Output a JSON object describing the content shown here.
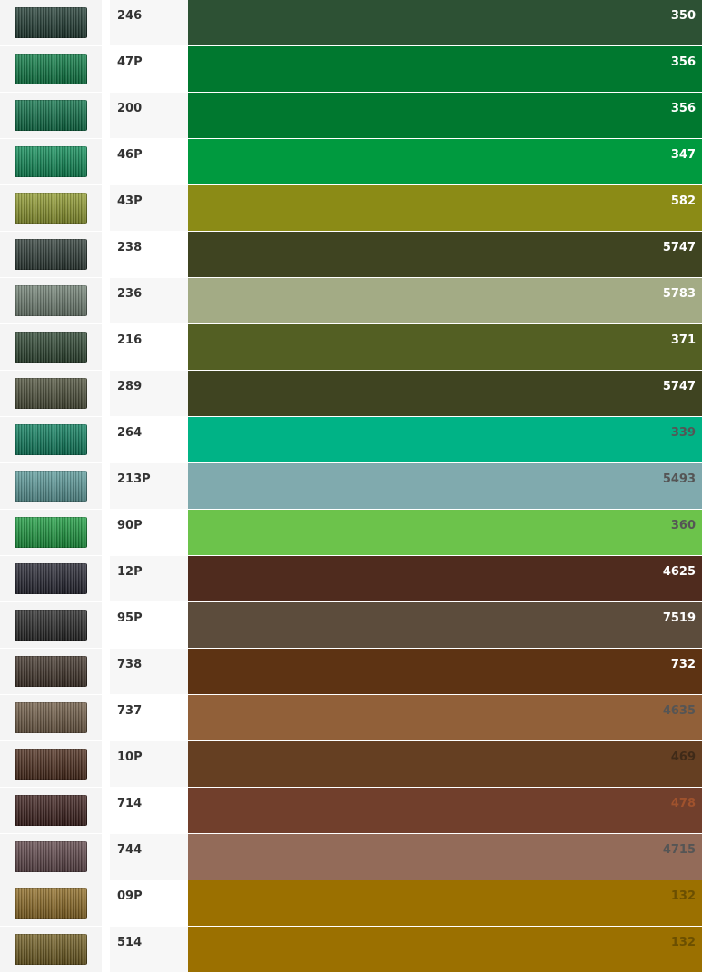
{
  "rows": [
    {
      "code": "246",
      "number": "350",
      "swatch": "#1f3a31",
      "color": "#2d5134",
      "text": "#ffffff"
    },
    {
      "code": "47P",
      "number": "356",
      "swatch": "#0a7a43",
      "color": "#00782f",
      "text": "#ffffff"
    },
    {
      "code": "200",
      "number": "356",
      "swatch": "#0b6f46",
      "color": "#00782f",
      "text": "#ffffff"
    },
    {
      "code": "46P",
      "number": "347",
      "swatch": "#0c8a55",
      "color": "#009a3f",
      "text": "#ffffff"
    },
    {
      "code": "43P",
      "number": "582",
      "swatch": "#8f9a2e",
      "color": "#8b8b16",
      "text": "#ffffff"
    },
    {
      "code": "238",
      "number": "5747",
      "swatch": "#2c3a35",
      "color": "#3f4421",
      "text": "#ffffff"
    },
    {
      "code": "236",
      "number": "5783",
      "swatch": "#6f7f72",
      "color": "#a3ab85",
      "text": "#ffffff"
    },
    {
      "code": "216",
      "number": "371",
      "swatch": "#2c4530",
      "color": "#535f23",
      "text": "#ffffff"
    },
    {
      "code": "289",
      "number": "5747",
      "swatch": "#4b4e38",
      "color": "#3f4421",
      "text": "#ffffff"
    },
    {
      "code": "264",
      "number": "339",
      "swatch": "#0b7d5c",
      "color": "#00b386",
      "text": "#555555"
    },
    {
      "code": "213P",
      "number": "5493",
      "swatch": "#5b9a9a",
      "color": "#80aaae",
      "text": "#555555"
    },
    {
      "code": "90P",
      "number": "360",
      "swatch": "#1a9a3e",
      "color": "#6cc34b",
      "text": "#555555"
    },
    {
      "code": "12P",
      "number": "4625",
      "swatch": "#23232f",
      "color": "#4f2b1e",
      "text": "#ffffff"
    },
    {
      "code": "95P",
      "number": "7519",
      "swatch": "#262626",
      "color": "#5c4c3c",
      "text": "#ffffff"
    },
    {
      "code": "738",
      "number": "732",
      "swatch": "#3e3127",
      "color": "#5d3313",
      "text": "#ffffff"
    },
    {
      "code": "737",
      "number": "4635",
      "swatch": "#6e5a44",
      "color": "#916039",
      "text": "#555555"
    },
    {
      "code": "10P",
      "number": "469",
      "swatch": "#4a2a1a",
      "color": "#653f22",
      "text": "#3f2a18"
    },
    {
      "code": "714",
      "number": "478",
      "swatch": "#3a1d1a",
      "color": "#713f2c",
      "text": "#a0522d"
    },
    {
      "code": "744",
      "number": "4715",
      "swatch": "#5d4448",
      "color": "#936b59",
      "text": "#555555"
    },
    {
      "code": "09P",
      "number": "132",
      "swatch": "#8d6a23",
      "color": "#9b7000",
      "text": "#6b4f00"
    },
    {
      "code": "514",
      "number": "132",
      "swatch": "#6e5b1f",
      "color": "#9b7000",
      "text": "#6b4f00"
    }
  ]
}
